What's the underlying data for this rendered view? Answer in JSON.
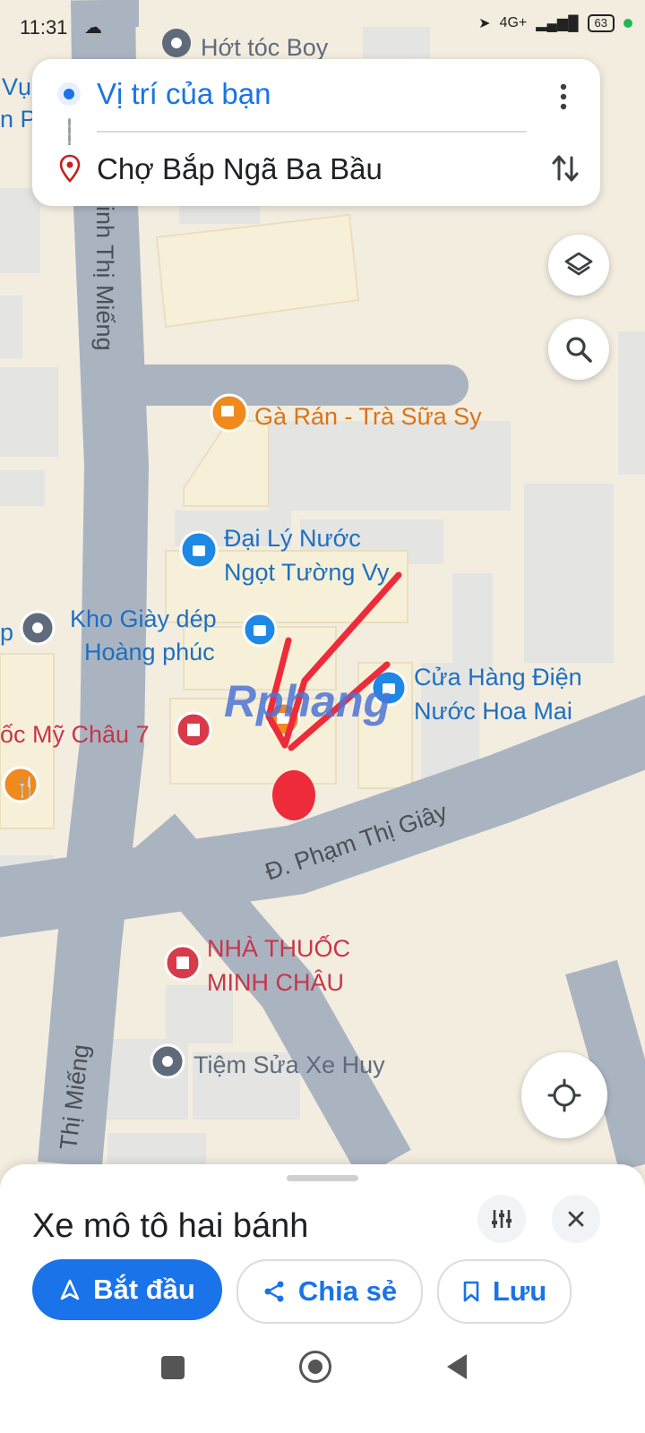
{
  "status": {
    "time": "11:31",
    "network": "4G+",
    "battery": "63"
  },
  "route": {
    "origin": "Vị trí của bạn",
    "destination": "Chợ Bắp Ngã Ba Bầu"
  },
  "map": {
    "streets": [
      "Đ. Phạm Thị Giây",
      "inh Thị Miếng",
      "Thị Miếng"
    ],
    "places": [
      {
        "name": "Hớt tóc Boy",
        "type": "pin"
      },
      {
        "name": "Gà Rán - Trà Sữa Sy",
        "type": "cafe"
      },
      {
        "name": "Đại Lý Nước Ngọt Tường Vy",
        "line1": "Đại Lý Nước",
        "line2": "Ngọt Tường Vy",
        "type": "shop"
      },
      {
        "name": "Kho Giày dép Hoàng phúc",
        "line1": "Kho Giày dép",
        "line2": "Hoàng phúc",
        "type": "shop"
      },
      {
        "name": "Cửa Hàng Điện Nước Hoa Mai",
        "line1": "Cửa Hàng Điện",
        "line2": "Nước Hoa Mai",
        "type": "shop"
      },
      {
        "name": "ốc Mỹ Châu 7",
        "type": "pharmacy"
      },
      {
        "name": "NHÀ THUỐC MINH CHÂU",
        "line1": "NHÀ THUỐC",
        "line2": "MINH CHÂU",
        "type": "pharmacy"
      },
      {
        "name": "Tiệm Sửa Xe Huy",
        "type": "pin"
      }
    ],
    "edge_labels": [
      "Vụ",
      "n P",
      "p"
    ],
    "watermark": "Rphang"
  },
  "sheet": {
    "mode": "Xe mô tô hai bánh",
    "start_label": "Bắt đầu",
    "share_label": "Chia sẻ",
    "save_label": "Lưu"
  },
  "colors": {
    "accent": "#1a73e8",
    "road": "#aab4c1",
    "block": "#e6e6e6",
    "building": "#f6efd7",
    "poi_blue": "#1e88e5",
    "poi_red": "#d93a4a",
    "poi_orange": "#f08a1c"
  }
}
